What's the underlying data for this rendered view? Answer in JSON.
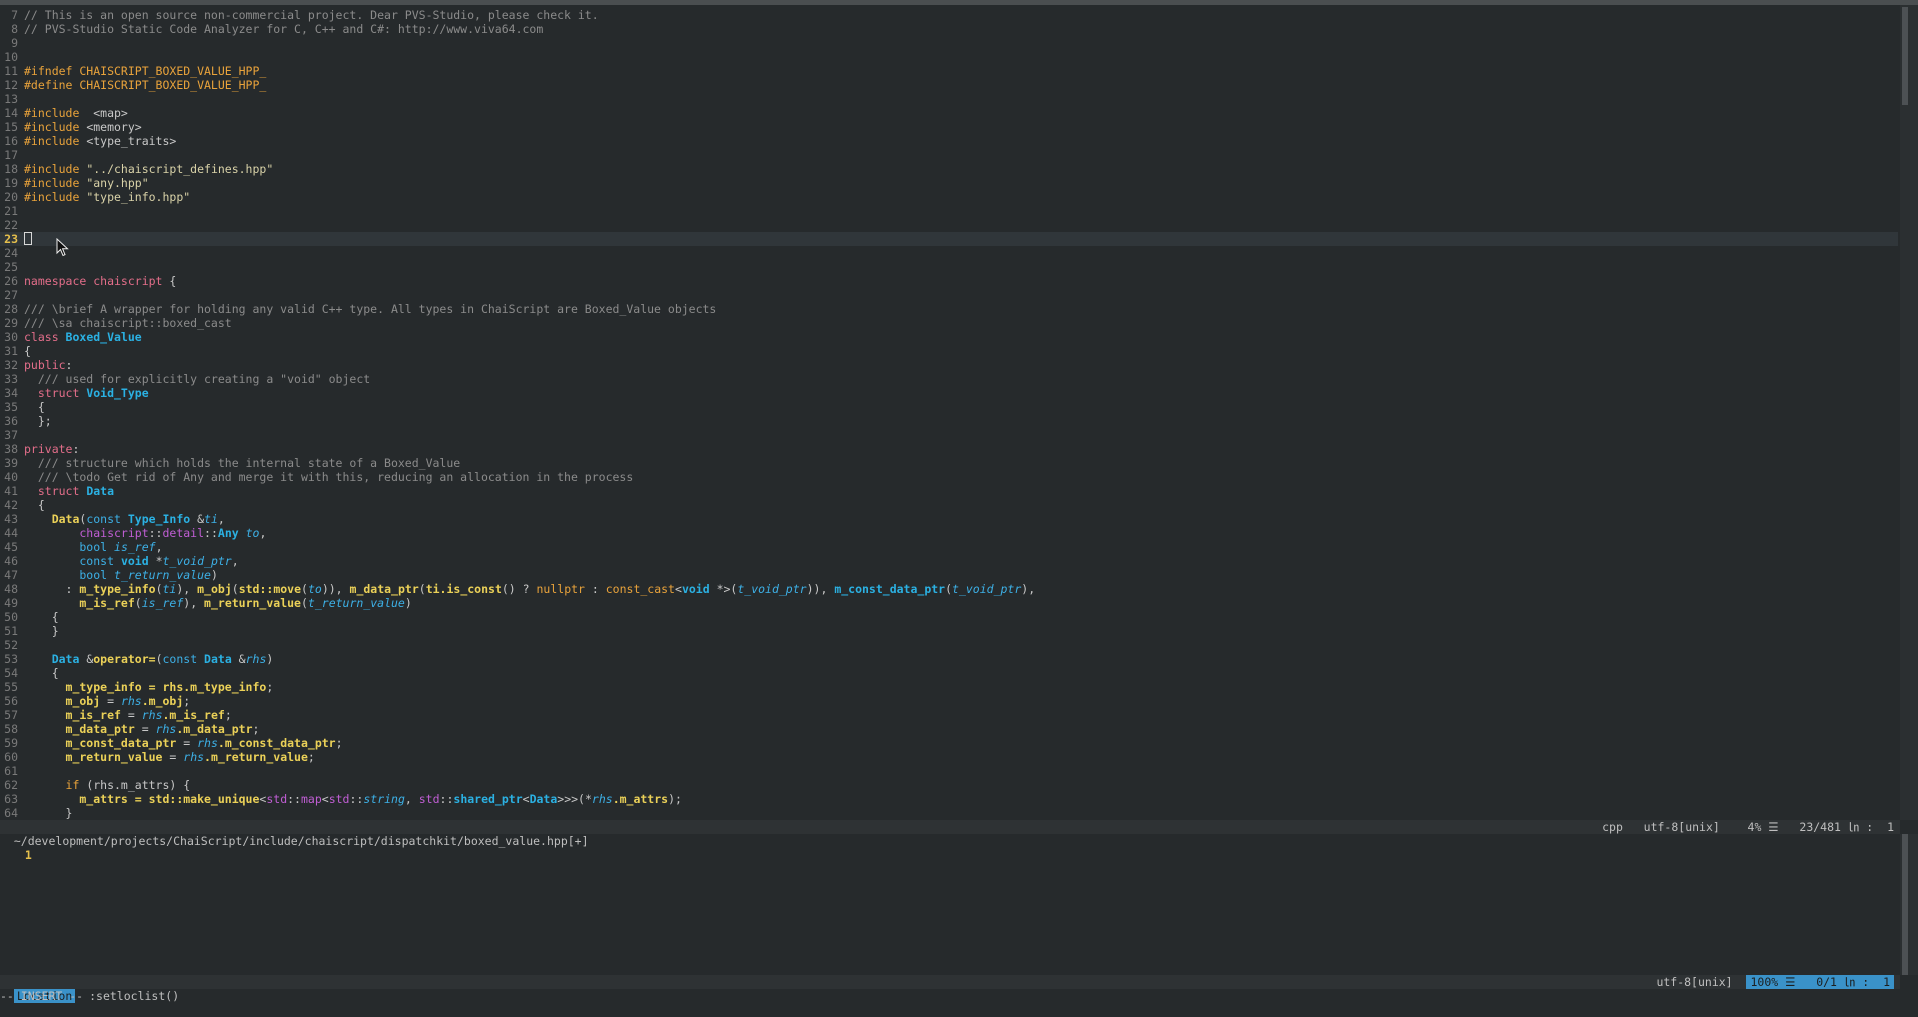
{
  "editor": {
    "lines": [
      {
        "n": "7",
        "segs": [
          [
            "cm",
            "// This is an open source non-commercial project. Dear PVS-Studio, please check it."
          ]
        ]
      },
      {
        "n": "8",
        "segs": [
          [
            "cm",
            "// PVS-Studio Static Code Analyzer for C, C++ and C#: http://www.viva64.com"
          ]
        ]
      },
      {
        "n": "9",
        "segs": []
      },
      {
        "n": "10",
        "segs": []
      },
      {
        "n": "11",
        "segs": [
          [
            "pp",
            "#ifndef CHAISCRIPT_BOXED_VALUE_HPP_"
          ]
        ]
      },
      {
        "n": "12",
        "segs": [
          [
            "pp",
            "#define CHAISCRIPT_BOXED_VALUE_HPP_"
          ]
        ]
      },
      {
        "n": "13",
        "segs": []
      },
      {
        "n": "14",
        "segs": [
          [
            "pp",
            "#include"
          ],
          [
            "",
            "  <map>"
          ]
        ]
      },
      {
        "n": "15",
        "segs": [
          [
            "pp",
            "#include"
          ],
          [
            "",
            " <memory>"
          ]
        ]
      },
      {
        "n": "16",
        "segs": [
          [
            "pp",
            "#include"
          ],
          [
            "",
            " <type_traits>"
          ]
        ]
      },
      {
        "n": "17",
        "segs": []
      },
      {
        "n": "18",
        "segs": [
          [
            "pp",
            "#include"
          ],
          [
            "st",
            " \"../chaiscript_defines.hpp\""
          ]
        ]
      },
      {
        "n": "19",
        "segs": [
          [
            "pp",
            "#include"
          ],
          [
            "st",
            " \"any.hpp\""
          ]
        ]
      },
      {
        "n": "20",
        "segs": [
          [
            "pp",
            "#include"
          ],
          [
            "st",
            " \"type_info.hpp\""
          ]
        ]
      },
      {
        "n": "21",
        "segs": []
      },
      {
        "n": "22",
        "segs": []
      },
      {
        "n": "23",
        "segs": [],
        "current": true
      },
      {
        "n": "24",
        "segs": []
      },
      {
        "n": "25",
        "segs": []
      },
      {
        "n": "26",
        "segs": [
          [
            "ky",
            "namespace chaiscript"
          ],
          [
            "",
            " {"
          ]
        ]
      },
      {
        "n": "27",
        "segs": []
      },
      {
        "n": "28",
        "segs": [
          [
            "cm",
            "/// \\brief A wrapper for holding any valid C++ type. All types in ChaiScript are Boxed_Value objects"
          ]
        ]
      },
      {
        "n": "29",
        "segs": [
          [
            "cm",
            "/// \\sa chaiscript::boxed_cast"
          ]
        ]
      },
      {
        "n": "30",
        "segs": [
          [
            "ky",
            "class "
          ],
          [
            "ty",
            "Boxed_Value"
          ]
        ]
      },
      {
        "n": "31",
        "segs": [
          [
            "",
            "{"
          ]
        ]
      },
      {
        "n": "32",
        "segs": [
          [
            "ky",
            "public"
          ],
          [
            "",
            ":"
          ]
        ]
      },
      {
        "n": "33",
        "segs": [
          [
            "cm",
            "  /// used for explicitly creating a \"void\" object"
          ]
        ]
      },
      {
        "n": "34",
        "segs": [
          [
            "ky",
            "  struct "
          ],
          [
            "ty",
            "Void_Type"
          ]
        ]
      },
      {
        "n": "35",
        "segs": [
          [
            "",
            "  {"
          ]
        ]
      },
      {
        "n": "36",
        "segs": [
          [
            "",
            "  };"
          ]
        ]
      },
      {
        "n": "37",
        "segs": []
      },
      {
        "n": "38",
        "segs": [
          [
            "ky",
            "private"
          ],
          [
            "",
            ":"
          ]
        ]
      },
      {
        "n": "39",
        "segs": [
          [
            "cm",
            "  /// structure which holds the internal state of a Boxed_Value"
          ]
        ]
      },
      {
        "n": "40",
        "segs": [
          [
            "cm",
            "  /// \\todo Get rid of Any and merge it with this, reducing an allocation in the process"
          ]
        ]
      },
      {
        "n": "41",
        "segs": [
          [
            "ky",
            "  struct "
          ],
          [
            "ty",
            "Data"
          ]
        ]
      },
      {
        "n": "42",
        "segs": [
          [
            "",
            "  {"
          ]
        ]
      },
      {
        "n": "43",
        "segs": [
          [
            "fn",
            "    Data"
          ],
          [
            "",
            "("
          ],
          [
            "tp",
            "const "
          ],
          [
            "ty",
            "Type_Info"
          ],
          [
            "",
            " &"
          ],
          [
            "pa",
            "ti"
          ],
          [
            "",
            ","
          ]
        ]
      },
      {
        "n": "44",
        "segs": [
          [
            "ns",
            "        chaiscript"
          ],
          [
            "",
            "::"
          ],
          [
            "ns",
            "detail"
          ],
          [
            "",
            "::"
          ],
          [
            "ty",
            "Any"
          ],
          [
            "pa",
            " to"
          ],
          [
            "",
            ","
          ]
        ]
      },
      {
        "n": "45",
        "segs": [
          [
            "tp",
            "        bool "
          ],
          [
            "pa",
            "is_ref"
          ],
          [
            "",
            ","
          ]
        ]
      },
      {
        "n": "46",
        "segs": [
          [
            "tp",
            "        const "
          ],
          [
            "ty",
            "void"
          ],
          [
            "",
            " *"
          ],
          [
            "pa",
            "t_void_ptr"
          ],
          [
            "",
            ","
          ]
        ]
      },
      {
        "n": "47",
        "segs": [
          [
            "tp",
            "        bool "
          ],
          [
            "pa",
            "t_return_value"
          ],
          [
            "",
            ")"
          ]
        ]
      },
      {
        "n": "48",
        "segs": [
          [
            "",
            "      : "
          ],
          [
            "fn",
            "m_type_info"
          ],
          [
            "",
            "("
          ],
          [
            "pa",
            "ti"
          ],
          [
            "",
            "), "
          ],
          [
            "fn",
            "m_obj"
          ],
          [
            "",
            "("
          ],
          [
            "fn",
            "std::move"
          ],
          [
            "",
            "("
          ],
          [
            "pa",
            "to"
          ],
          [
            "",
            ")), "
          ],
          [
            "fn",
            "m_data_ptr"
          ],
          [
            "",
            "("
          ],
          [
            "fn",
            "ti.is_const"
          ],
          [
            "",
            "() ? "
          ],
          [
            "pp",
            "nullptr"
          ],
          [
            "",
            " : "
          ],
          [
            "pp",
            "const_cast"
          ],
          [
            "",
            "<"
          ],
          [
            "ty",
            "void"
          ],
          [
            "",
            " *>("
          ],
          [
            "pa",
            "t_void_ptr"
          ],
          [
            "",
            "))"
          ],
          [
            "",
            ", "
          ],
          [
            "ty",
            "m_const_data_ptr"
          ],
          [
            "",
            "("
          ],
          [
            "pa",
            "t_void_ptr"
          ],
          [
            "",
            "),"
          ]
        ]
      },
      {
        "n": "49",
        "segs": [
          [
            "fn",
            "        m_is_ref"
          ],
          [
            "",
            "("
          ],
          [
            "pa",
            "is_ref"
          ],
          [
            "",
            "), "
          ],
          [
            "fn",
            "m_return_value"
          ],
          [
            "",
            "("
          ],
          [
            "pa",
            "t_return_value"
          ],
          [
            "",
            ")"
          ]
        ]
      },
      {
        "n": "50",
        "segs": [
          [
            "",
            "    {"
          ]
        ]
      },
      {
        "n": "51",
        "segs": [
          [
            "",
            "    }"
          ]
        ]
      },
      {
        "n": "52",
        "segs": []
      },
      {
        "n": "53",
        "segs": [
          [
            "ty",
            "    Data"
          ],
          [
            "",
            " &"
          ],
          [
            "fn",
            "operator="
          ],
          [
            "",
            "("
          ],
          [
            "tp",
            "const "
          ],
          [
            "ty",
            "Data"
          ],
          [
            "",
            " &"
          ],
          [
            "pa",
            "rhs"
          ],
          [
            "",
            ")"
          ]
        ]
      },
      {
        "n": "54",
        "segs": [
          [
            "",
            "    {"
          ]
        ]
      },
      {
        "n": "55",
        "segs": [
          [
            "fn",
            "      m_type_info = rhs.m_type_info"
          ],
          [
            "",
            ";"
          ]
        ]
      },
      {
        "n": "56",
        "segs": [
          [
            "fn",
            "      m_obj"
          ],
          [
            "",
            " = "
          ],
          [
            "pa",
            "rhs"
          ],
          [
            "fn",
            ".m_obj"
          ],
          [
            "",
            ";"
          ]
        ]
      },
      {
        "n": "57",
        "segs": [
          [
            "fn",
            "      m_is_ref"
          ],
          [
            "",
            " = "
          ],
          [
            "pa",
            "rhs"
          ],
          [
            "fn",
            ".m_is_ref"
          ],
          [
            "",
            ";"
          ]
        ]
      },
      {
        "n": "58",
        "segs": [
          [
            "fn",
            "      m_data_ptr"
          ],
          [
            "",
            " = "
          ],
          [
            "pa",
            "rhs"
          ],
          [
            "fn",
            ".m_data_ptr"
          ],
          [
            "",
            ";"
          ]
        ]
      },
      {
        "n": "59",
        "segs": [
          [
            "fn",
            "      m_const_data_ptr"
          ],
          [
            "",
            " = "
          ],
          [
            "pa",
            "rhs"
          ],
          [
            "fn",
            ".m_const_data_ptr"
          ],
          [
            "",
            ";"
          ]
        ]
      },
      {
        "n": "60",
        "segs": [
          [
            "fn",
            "      m_return_value"
          ],
          [
            "",
            " = "
          ],
          [
            "pa",
            "rhs"
          ],
          [
            "fn",
            ".m_return_value"
          ],
          [
            "",
            ";"
          ]
        ]
      },
      {
        "n": "61",
        "segs": []
      },
      {
        "n": "62",
        "segs": [
          [
            "pp",
            "      if"
          ],
          [
            "",
            " (rhs.m_attrs) {"
          ]
        ]
      },
      {
        "n": "63",
        "segs": [
          [
            "fn",
            "        m_attrs = std::make_unique"
          ],
          [
            "",
            "<"
          ],
          [
            "ns",
            "std"
          ],
          [
            "",
            "::"
          ],
          [
            "ns",
            "map"
          ],
          [
            "",
            "<"
          ],
          [
            "ns",
            "std"
          ],
          [
            "",
            "::"
          ],
          [
            "pa",
            "string"
          ],
          [
            "",
            ", "
          ],
          [
            "ns",
            "std"
          ],
          [
            "",
            "::"
          ],
          [
            "ty",
            "shared_ptr"
          ],
          [
            "",
            "<"
          ],
          [
            "ty",
            "Data"
          ],
          [
            "",
            ">>>(*"
          ],
          [
            "pa",
            "rhs"
          ],
          [
            "fn",
            ".m_attrs"
          ],
          [
            "",
            ");"
          ]
        ]
      },
      {
        "n": "64",
        "segs": [
          [
            "",
            "      }"
          ]
        ]
      }
    ]
  },
  "statusline": {
    "path": "~/development/projects/ChaiScript/include/chaiscript/dispatchkit/boxed_value.hpp[+]",
    "filetype": "cpp",
    "encoding": "utf-8[unix]",
    "percent": "4% ☰",
    "position": "23/481 ㏑ :  1"
  },
  "location": {
    "line_number": "1",
    "tag": "Location",
    "command": ":setloclist()",
    "encoding": "utf-8[unix]",
    "percent": "100% ☰",
    "position": "0/1 ㏑ :  1"
  },
  "cmdline": "-- INSERT --",
  "colors": {
    "accent": "#3a92c9",
    "background": "#262a2c",
    "keyword": "#e36e8a",
    "type": "#3db0e6",
    "function": "#ebd158",
    "preproc": "#e9a33b"
  }
}
